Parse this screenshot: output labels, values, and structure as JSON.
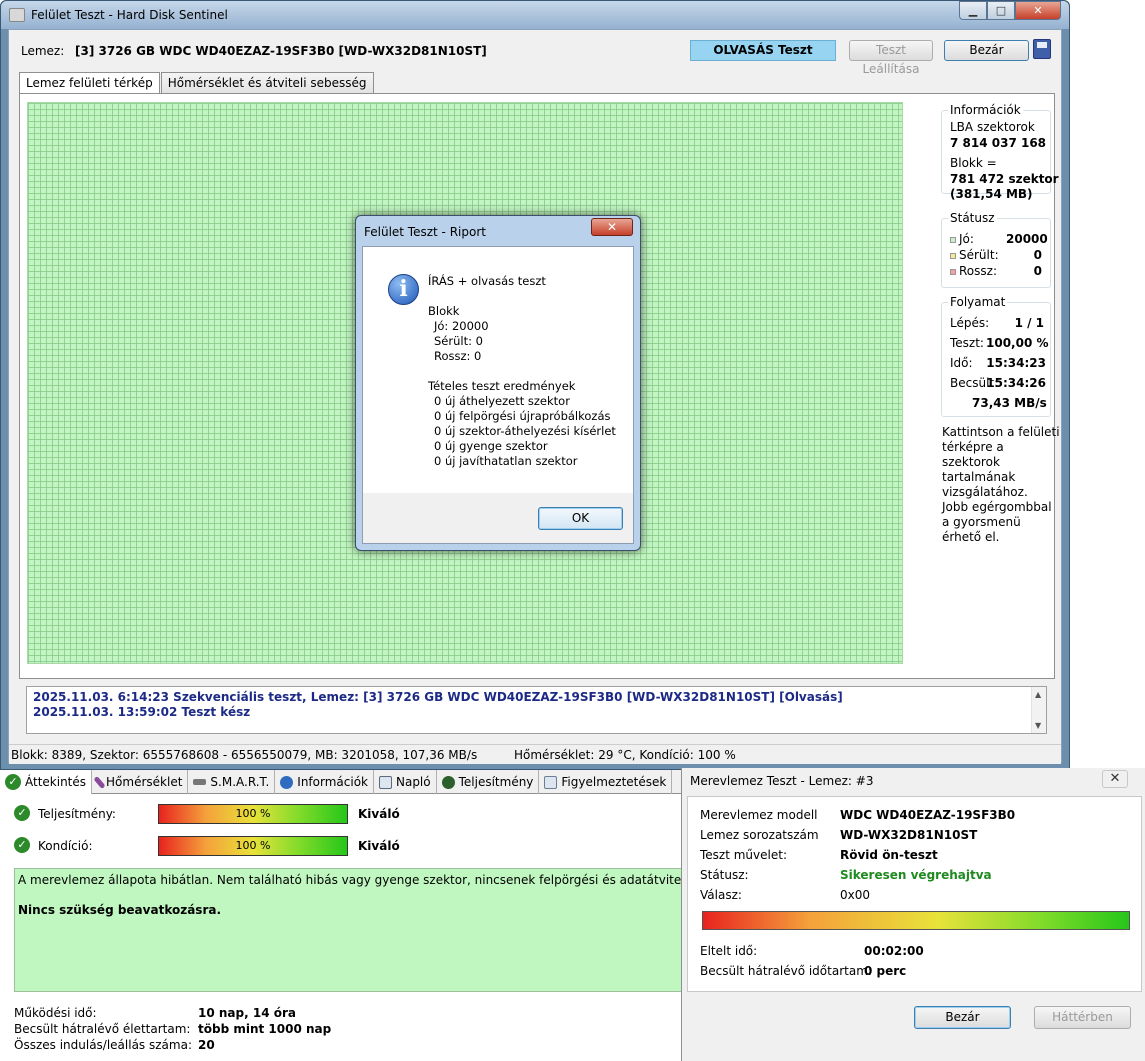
{
  "main_window": {
    "title": "Felület Teszt - Hard Disk Sentinel",
    "caption_min": "▁",
    "caption_max": "□",
    "caption_close": "✕",
    "disk_label": "Lemez:",
    "disk_name": "[3] 3726 GB  WDC WD40EZAZ-19SF3B0 [WD-WX32D81N10ST]",
    "mode_button": "OLVASÁS Teszt",
    "stop_button": "Teszt Leállítása",
    "close_button": "Bezár",
    "tabs": [
      {
        "label": "Lemez felületi térkép"
      },
      {
        "label": "Hőmérséklet és átviteli sebesség"
      }
    ]
  },
  "info_panel": {
    "info_title": "Információk",
    "lba_label": "LBA szektorok",
    "lba_value": "7 814 037 168",
    "block_label": "Blokk =",
    "block_value": "781 472 szektor",
    "block_size": "(381,54 MB)",
    "status_title": "Státusz",
    "good_label": "Jó:",
    "good_value": "20000",
    "damaged_label": "Sérült:",
    "damaged_value": "0",
    "bad_label": "Rossz:",
    "bad_value": "0",
    "progress_title": "Folyamat",
    "step_label": "Lépés:",
    "step_value": "1 / 1",
    "test_label": "Teszt:",
    "test_value": "100,00 %",
    "time_label": "Idő:",
    "time_value": "15:34:23",
    "est_label": "Becsült:",
    "est_value": "15:34:26",
    "speed_value": "73,43 MB/s",
    "help_1": "Kattintson a felületi térképre a szektorok tartalmának vizsgálatához.",
    "help_2": "Jobb egérgombbal a gyorsmenü érhető el."
  },
  "log": {
    "line1": "2025.11.03.  6:14:23   Szekvenciális teszt, Lemez: [3] 3726 GB  WDC WD40EZAZ-19SF3B0 [WD-WX32D81N10ST] [Olvasás]",
    "line2": "2025.11.03.  13:59:02   Teszt kész"
  },
  "status_bar": {
    "left": "Blokk: 8389, Szektor: 6555768608 - 6556550079, MB: 3201058, 107,36 MB/s",
    "right": "Hőmérséklet: 29  °C,  Kondíció: 100 %"
  },
  "report_dialog": {
    "title": "Felület Teszt - Riport",
    "close": "✕",
    "icon": "i",
    "heading": "ÍRÁS + olvasás teszt",
    "blocks_title": "Blokk",
    "good": "Jó: 20000",
    "damaged": "Sérült: 0",
    "bad": "Rossz: 0",
    "results_title": "Tételes teszt eredmények",
    "r1": "0 új áthelyezett szektor",
    "r2": "0 új felpörgési újrapróbálkozás",
    "r3": "0 új szektor-áthelyezési kísérlet",
    "r4": "0 új gyenge szektor",
    "r5": "0 új javíthatatlan szektor",
    "ok": "OK"
  },
  "overview": {
    "tabs": [
      {
        "label": "Áttekintés",
        "icon": "check-icon",
        "color": "#2d8a2a"
      },
      {
        "label": "Hőmérséklet",
        "icon": "thermometer-icon",
        "color": "#8a4b9a"
      },
      {
        "label": "S.M.A.R.T.",
        "icon": "smart-icon",
        "color": "#777777"
      },
      {
        "label": "Információk",
        "icon": "info-icon",
        "color": "#2f6cc0"
      },
      {
        "label": "Napló",
        "icon": "log-icon",
        "color": "#5a6b80"
      },
      {
        "label": "Teljesítmény",
        "icon": "gauge-icon",
        "color": "#2b5f2b"
      },
      {
        "label": "Figyelmeztetések",
        "icon": "alerts-icon",
        "color": "#6b7d95"
      }
    ],
    "perf_label": "Teljesítmény:",
    "perf_bar": "100 %",
    "perf_percent": 100,
    "perf_value": "Kiváló",
    "cond_label": "Kondíció:",
    "cond_bar": "100 %",
    "cond_percent": 100,
    "cond_value": "Kiváló",
    "health_line": "A merevlemez állapota hibátlan. Nem található hibás vagy gyenge szektor, nincsenek felpörgési és adatátviteli hibák sem.",
    "health_action": "Nincs szükség beavatkozásra.",
    "uptime_label": "Működési idő:",
    "uptime_value": "10 nap, 14 óra",
    "life_label": "Becsült hátralévő élettartam:",
    "life_value": "több mint 1000 nap",
    "starts_label": "Összes indulás/leállás száma:",
    "starts_value": "20"
  },
  "hdd_test": {
    "title": "Merevlemez Teszt - Lemez: #3",
    "close": "✕",
    "model_label": "Merevlemez modell",
    "model_value": "WDC WD40EZAZ-19SF3B0",
    "serial_label": "Lemez sorozatszám",
    "serial_value": "WD-WX32D81N10ST",
    "op_label": "Teszt művelet:",
    "op_value": "Rövid ön-teszt",
    "status_label": "Státusz:",
    "status_value": "Sikeresen végrehajtva",
    "status_color": "#1f8a1f",
    "resp_label": "Válasz:",
    "resp_value": "0x00",
    "progress": 1.0,
    "elapsed_label": "Eltelt idő:",
    "elapsed_value": "00:02:00",
    "remain_label": "Becsült hátralévő időtartam:",
    "remain_value": "0 perc",
    "close_button": "Bezár",
    "background_button": "Háttérben"
  }
}
